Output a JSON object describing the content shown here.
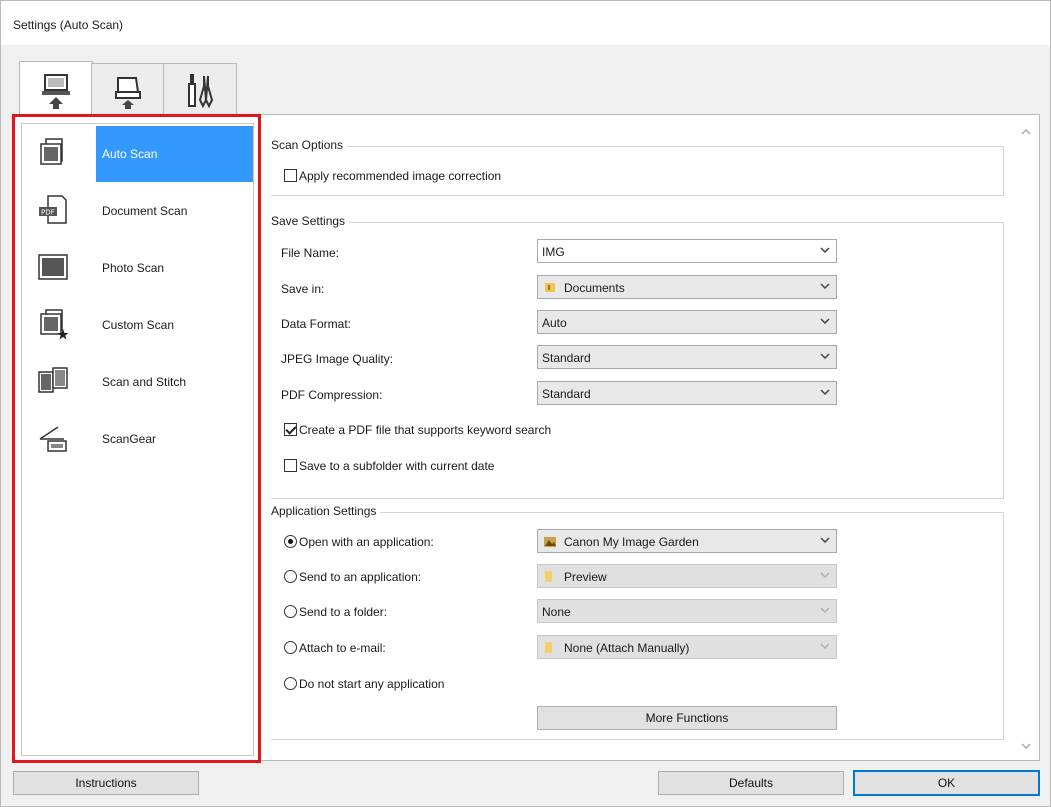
{
  "window": {
    "title": "Settings (Auto Scan)"
  },
  "tabs": [
    {
      "name": "scan-from-computer",
      "icon": "computer-scan-icon",
      "active": true
    },
    {
      "name": "scan-from-operation-panel",
      "icon": "scanner-panel-icon",
      "active": false
    },
    {
      "name": "general-settings",
      "icon": "tools-icon",
      "active": false
    }
  ],
  "sidebar": {
    "items": [
      {
        "label": "Auto Scan",
        "icon": "auto-scan-icon",
        "selected": true
      },
      {
        "label": "Document Scan",
        "icon": "pdf-document-icon",
        "selected": false
      },
      {
        "label": "Photo Scan",
        "icon": "photo-icon",
        "selected": false
      },
      {
        "label": "Custom Scan",
        "icon": "custom-scan-star-icon",
        "selected": false
      },
      {
        "label": "Scan and Stitch",
        "icon": "stitch-icon",
        "selected": false
      },
      {
        "label": "ScanGear",
        "icon": "scangear-icon",
        "selected": false
      }
    ]
  },
  "scan_options": {
    "title": "Scan Options",
    "apply_correction": {
      "label": "Apply recommended image correction",
      "checked": false
    }
  },
  "save_settings": {
    "title": "Save Settings",
    "file_name": {
      "label": "File Name:",
      "value": "IMG"
    },
    "save_in": {
      "label": "Save in:",
      "value": "Documents",
      "icon": "folder-icon"
    },
    "data_format": {
      "label": "Data Format:",
      "value": "Auto"
    },
    "jpeg_quality": {
      "label": "JPEG Image Quality:",
      "value": "Standard"
    },
    "pdf_compression": {
      "label": "PDF Compression:",
      "value": "Standard"
    },
    "keyword_pdf": {
      "label": "Create a PDF file that supports keyword search",
      "checked": true
    },
    "subfolder": {
      "label": "Save to a subfolder with current date",
      "checked": false
    }
  },
  "application_settings": {
    "title": "Application Settings",
    "open_app": {
      "label": "Open with an application:",
      "checked": true,
      "value": "Canon My Image Garden",
      "icon": "image-garden-icon"
    },
    "send_app": {
      "label": "Send to an application:",
      "checked": false,
      "value": "Preview",
      "icon": "folder-icon"
    },
    "send_folder": {
      "label": "Send to a folder:",
      "checked": false,
      "value": "None"
    },
    "attach_email": {
      "label": "Attach to e-mail:",
      "checked": false,
      "value": "None (Attach Manually)",
      "icon": "folder-icon"
    },
    "no_app": {
      "label": "Do not start any application",
      "checked": false
    },
    "more_functions": "More Functions"
  },
  "footer": {
    "instructions": "Instructions",
    "defaults": "Defaults",
    "ok": "OK"
  },
  "colors": {
    "highlight": "#e3161b",
    "selection": "#3399ff",
    "default_button_border": "#0078d7"
  }
}
